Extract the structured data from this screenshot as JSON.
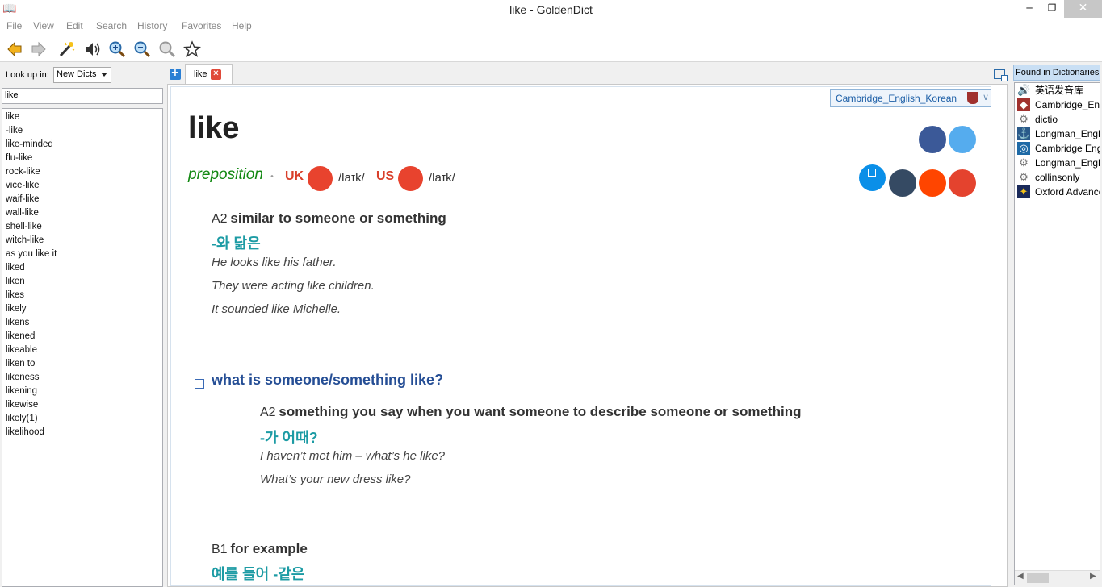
{
  "window": {
    "title": "like - GoldenDict",
    "min": "─",
    "max": "❐",
    "close": "✕"
  },
  "menu": [
    "File",
    "View",
    "Edit",
    "Search",
    "History",
    "Favorites",
    "Help"
  ],
  "toolbar": {
    "buttons": [
      "back-icon",
      "forward-icon",
      "scan-wand-icon",
      "speaker-icon",
      "zoom-in-icon",
      "zoom-out-icon",
      "zoom-reset-icon",
      "favorite-star-icon"
    ]
  },
  "left": {
    "lookup_label": "Look up in:",
    "group_value": "New Dicts",
    "search_value": "like",
    "words": [
      "like",
      "-like",
      "like-minded",
      "flu-like",
      "rock-like",
      "vice-like",
      "waif-like",
      "wall-like",
      "shell-like",
      "witch-like",
      "as you like it",
      "liked",
      "liken",
      "likes",
      "likely",
      "likens",
      "likened",
      "likeable",
      "liken to",
      "likeness",
      "likening",
      "likewise",
      "likely(1)",
      "likelihood"
    ]
  },
  "tabs": {
    "add": "+",
    "items": [
      {
        "label": "like",
        "close": "✕"
      }
    ]
  },
  "article": {
    "dict_name": "Cambridge_English_Korean",
    "chevron": "∨",
    "headword": "like",
    "pos": "preposition",
    "sep": "•",
    "uk_label": "UK",
    "uk_ipa": "/laɪk/",
    "us_label": "US",
    "us_ipa": "/laɪk/",
    "senses": [
      {
        "level": "A2",
        "definition": "similar to someone or something",
        "translation": "-와 닮은",
        "examples": [
          "He looks like his father.",
          "They were acting like children.",
          "It sounded like Michelle."
        ]
      }
    ],
    "phrase": {
      "title": "what is someone/something like?",
      "level": "A2",
      "definition": "something you say when you want someone to describe someone or something",
      "translation": "-가 어때?",
      "examples": [
        "I haven’t met him – what’s he like?",
        "What’s your new dress like?"
      ]
    },
    "sense2": {
      "level": "B1",
      "definition": "for example",
      "translation": "예를 들어 -같은"
    },
    "scroll_up": "▲",
    "scroll_down": "▼"
  },
  "found": {
    "title": "Found in Dictionaries:",
    "items": [
      {
        "name": "英语发音库",
        "icon": "speaker-icon"
      },
      {
        "name": "Cambridge_English_Korean",
        "icon": "cambridge-shield-icon"
      },
      {
        "name": "dictio",
        "icon": "gear-icon"
      },
      {
        "name": "Longman_English",
        "icon": "longman-ship-icon"
      },
      {
        "name": "Cambridge English",
        "icon": "cambridge-search-icon"
      },
      {
        "name": "Longman_English",
        "icon": "gear-icon"
      },
      {
        "name": "collinsonly",
        "icon": "gear-icon"
      },
      {
        "name": "Oxford Advanced",
        "icon": "oxford-icon"
      }
    ],
    "scroll_left": "◀",
    "scroll_right": "▶"
  },
  "colors": {
    "pos": "#118811",
    "region": "#d9402b",
    "translation": "#1c9ba4",
    "phrase": "#254e95",
    "dict_header": "#1a5da6"
  }
}
